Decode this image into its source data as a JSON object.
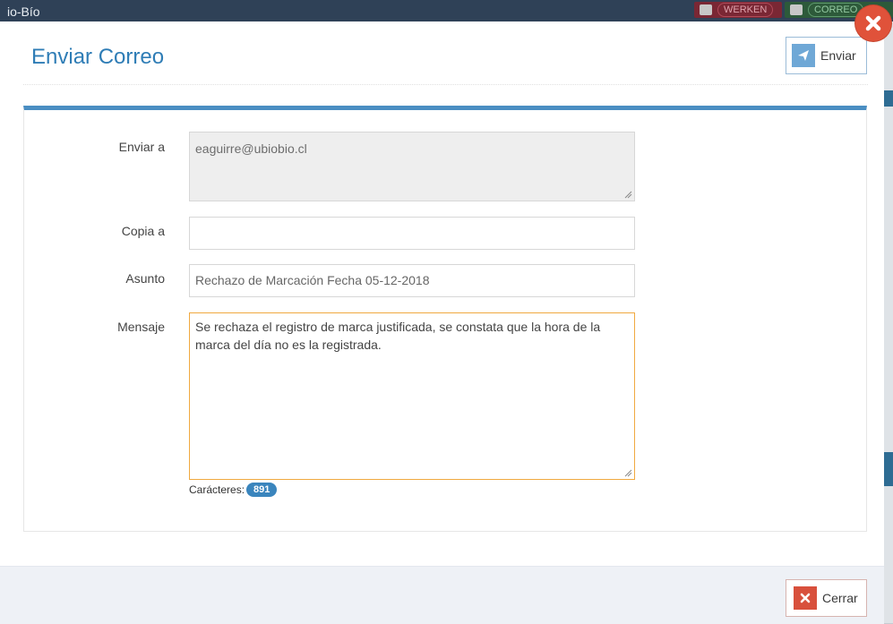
{
  "background": {
    "app_title": "io-Bío",
    "werken_label": "WERKEN",
    "correo_label": "CORREO"
  },
  "modal": {
    "title": "Enviar Correo",
    "send_label": "Enviar",
    "close_label": "Cerrar"
  },
  "form": {
    "to_label": "Enviar a",
    "to_value": "eaguirre@ubiobio.cl",
    "cc_label": "Copia a",
    "cc_value": "",
    "subject_label": "Asunto",
    "subject_value": "Rechazo de Marcación Fecha 05-12-2018",
    "message_label": "Mensaje",
    "message_value": "Se rechaza el registro de marca justificada, se constata que la hora de la marca del día no es la registrada.",
    "chars_label": "Carácteres:",
    "chars_count": "891"
  },
  "colors": {
    "accent": "#2f7db6",
    "panel_top_border": "#4a8ec2",
    "focus_border": "#f0a940",
    "close": "#e0523a"
  }
}
